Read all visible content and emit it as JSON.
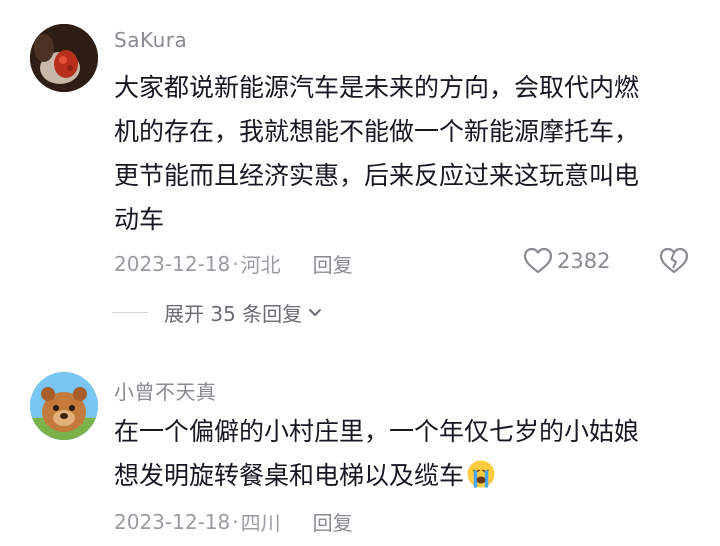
{
  "comments": [
    {
      "author": "SaKura",
      "lines": [
        "大家都说新能源汽车是未来的方向，会取代内燃",
        "机的存在，我就想能不能做一个新能源摩托车，",
        "更节能而且经济实惠，后来反应过来这玩意叫电",
        "动车"
      ],
      "date": "2023-12-18",
      "separator": "·",
      "location": "河北",
      "reply_label": "回复",
      "likes": "2382",
      "expand_label": "展开 35 条回复"
    },
    {
      "author": "小曾不天真",
      "lines": [
        "在一个偏僻的小村庄里，一个年仅七岁的小姑娘",
        "想发明旋转餐桌和电梯以及缆车"
      ],
      "emoji": "crying-face",
      "date": "2023-12-18",
      "separator": "·",
      "location": "四川",
      "reply_label": "回复"
    }
  ],
  "colors": {
    "text": "#161823",
    "muted": "#8a8b91",
    "meta": "#9b9ca1"
  }
}
